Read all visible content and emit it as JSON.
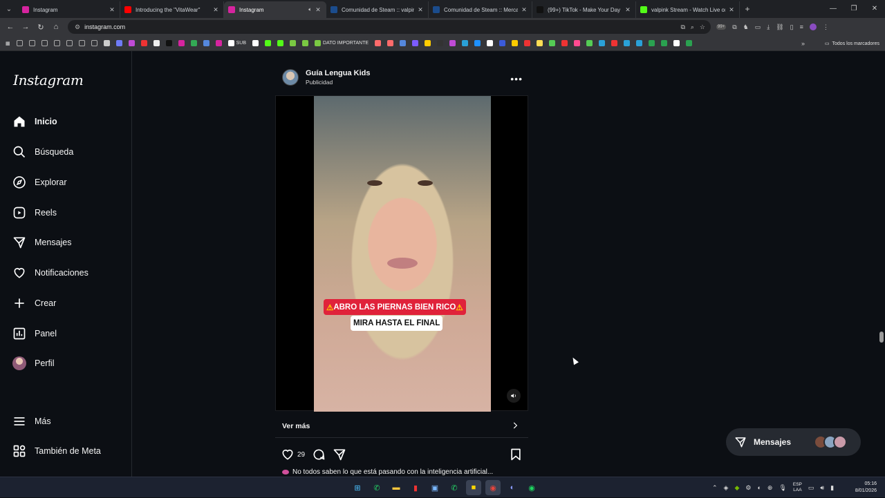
{
  "browser": {
    "tabs": [
      {
        "title": "Instagram",
        "favicon_color": "#d6249f",
        "active": false
      },
      {
        "title": "Introducing the \"VitaWear\"",
        "favicon_color": "#ff0000",
        "active": false
      },
      {
        "title": "Instagram",
        "favicon_color": "#d6249f",
        "active": true
      },
      {
        "title": "Comunidad de Steam :: valpink",
        "favicon_color": "#1b4c8c",
        "active": false
      },
      {
        "title": "Comunidad de Steam :: Mercad",
        "favicon_color": "#1b4c8c",
        "active": false
      },
      {
        "title": "(99+) TikTok - Make Your Day",
        "favicon_color": "#111111",
        "active": false
      },
      {
        "title": "valpink Stream - Watch Live on",
        "favicon_color": "#53fc18",
        "active": false
      }
    ],
    "url": "instagram.com",
    "notification_badge": "99+",
    "bookmarks": [
      {
        "label": "",
        "color": "#aaaaaa"
      },
      {
        "label": "",
        "color": "#aaaaaa"
      },
      {
        "label": "",
        "color": "#aaaaaa"
      },
      {
        "label": "",
        "color": "#aaaaaa"
      },
      {
        "label": "",
        "color": "#aaaaaa"
      },
      {
        "label": "",
        "color": "#aaaaaa"
      },
      {
        "label": "",
        "color": "#aaaaaa"
      },
      {
        "label": "",
        "color": "#cccccc"
      },
      {
        "label": "",
        "color": "#6f7bf7"
      },
      {
        "label": "",
        "color": "#c04bd7"
      },
      {
        "label": "",
        "color": "#e33"
      },
      {
        "label": "",
        "color": "#eeeeee"
      },
      {
        "label": "",
        "color": "#111111"
      },
      {
        "label": "",
        "color": "#d6249f"
      },
      {
        "label": "",
        "color": "#33aa55"
      },
      {
        "label": "",
        "color": "#5588dd"
      },
      {
        "label": "",
        "color": "#d6249f"
      },
      {
        "label": "SUB",
        "color": "#ffffff"
      },
      {
        "label": "",
        "color": "#ffffff"
      },
      {
        "label": "",
        "color": "#53fc18"
      },
      {
        "label": "",
        "color": "#53fc18"
      },
      {
        "label": "",
        "color": "#7ac943"
      },
      {
        "label": "",
        "color": "#7ac943"
      },
      {
        "label": "DATO IMPORTANTE",
        "color": "#7ac943"
      },
      {
        "label": "",
        "color": "#ff6b6b"
      },
      {
        "label": "",
        "color": "#ff6b6b"
      },
      {
        "label": "",
        "color": "#5588dd"
      },
      {
        "label": "",
        "color": "#7c5cff"
      },
      {
        "label": "",
        "color": "#ffcc00"
      },
      {
        "label": "",
        "color": "#333333"
      },
      {
        "label": "",
        "color": "#c04bd7"
      },
      {
        "label": "",
        "color": "#2aa1d8"
      },
      {
        "label": "",
        "color": "#1e90ff"
      },
      {
        "label": "",
        "color": "#ffffff"
      },
      {
        "label": "",
        "color": "#3b5bdb"
      },
      {
        "label": "",
        "color": "#ffcc00"
      },
      {
        "label": "",
        "color": "#e33"
      },
      {
        "label": "",
        "color": "#ffdd55"
      },
      {
        "label": "",
        "color": "#55cc55"
      },
      {
        "label": "",
        "color": "#e33"
      },
      {
        "label": "",
        "color": "#ff4b91"
      },
      {
        "label": "",
        "color": "#55cc55"
      },
      {
        "label": "",
        "color": "#2aa1d8"
      },
      {
        "label": "",
        "color": "#e33"
      },
      {
        "label": "",
        "color": "#2aa1d8"
      },
      {
        "label": "",
        "color": "#2aa1d8"
      },
      {
        "label": "",
        "color": "#2aa150"
      },
      {
        "label": "",
        "color": "#2aa150"
      },
      {
        "label": "",
        "color": "#ffffff"
      },
      {
        "label": "",
        "color": "#2aa150"
      }
    ],
    "all_bookmarks_label": "Todos los marcadores"
  },
  "instagram": {
    "logo": "Instagram",
    "nav": [
      {
        "label": "Inicio",
        "icon": "home-icon",
        "active": true
      },
      {
        "label": "Búsqueda",
        "icon": "search-icon",
        "active": false
      },
      {
        "label": "Explorar",
        "icon": "compass-icon",
        "active": false
      },
      {
        "label": "Reels",
        "icon": "reels-icon",
        "active": false
      },
      {
        "label": "Mensajes",
        "icon": "messages-icon",
        "active": false
      },
      {
        "label": "Notificaciones",
        "icon": "heart-icon",
        "active": false
      },
      {
        "label": "Crear",
        "icon": "plus-icon",
        "active": false
      },
      {
        "label": "Panel",
        "icon": "dashboard-icon",
        "active": false
      },
      {
        "label": "Perfil",
        "icon": "avatar",
        "active": false
      }
    ],
    "bottom_nav": [
      {
        "label": "Más",
        "icon": "menu-icon"
      },
      {
        "label": "También de Meta",
        "icon": "meta-icon"
      }
    ],
    "post": {
      "username": "Guía Lengua Kids",
      "subtitle": "Publicidad",
      "video_caption_line1": "ABRO LAS PIERNAS BIEN RICO",
      "video_caption_line2": "MIRA HASTA EL FINAL",
      "cta": "Ver más",
      "likes": "29",
      "caption": "No todos saben lo que está pasando con la inteligencia artificial..."
    },
    "messages_pill": {
      "label": "Mensajes"
    }
  },
  "taskbar": {
    "apps": [
      "windows-start-icon",
      "whatsapp-icon",
      "file-explorer-icon",
      "app-icon",
      "app-icon",
      "whatsapp-icon",
      "sticky-notes-icon",
      "chrome-icon",
      "discord-icon",
      "spotify-icon"
    ],
    "language": "ESP",
    "language_sub": "LAA",
    "time": "05:16",
    "date": "8/01/2026"
  }
}
